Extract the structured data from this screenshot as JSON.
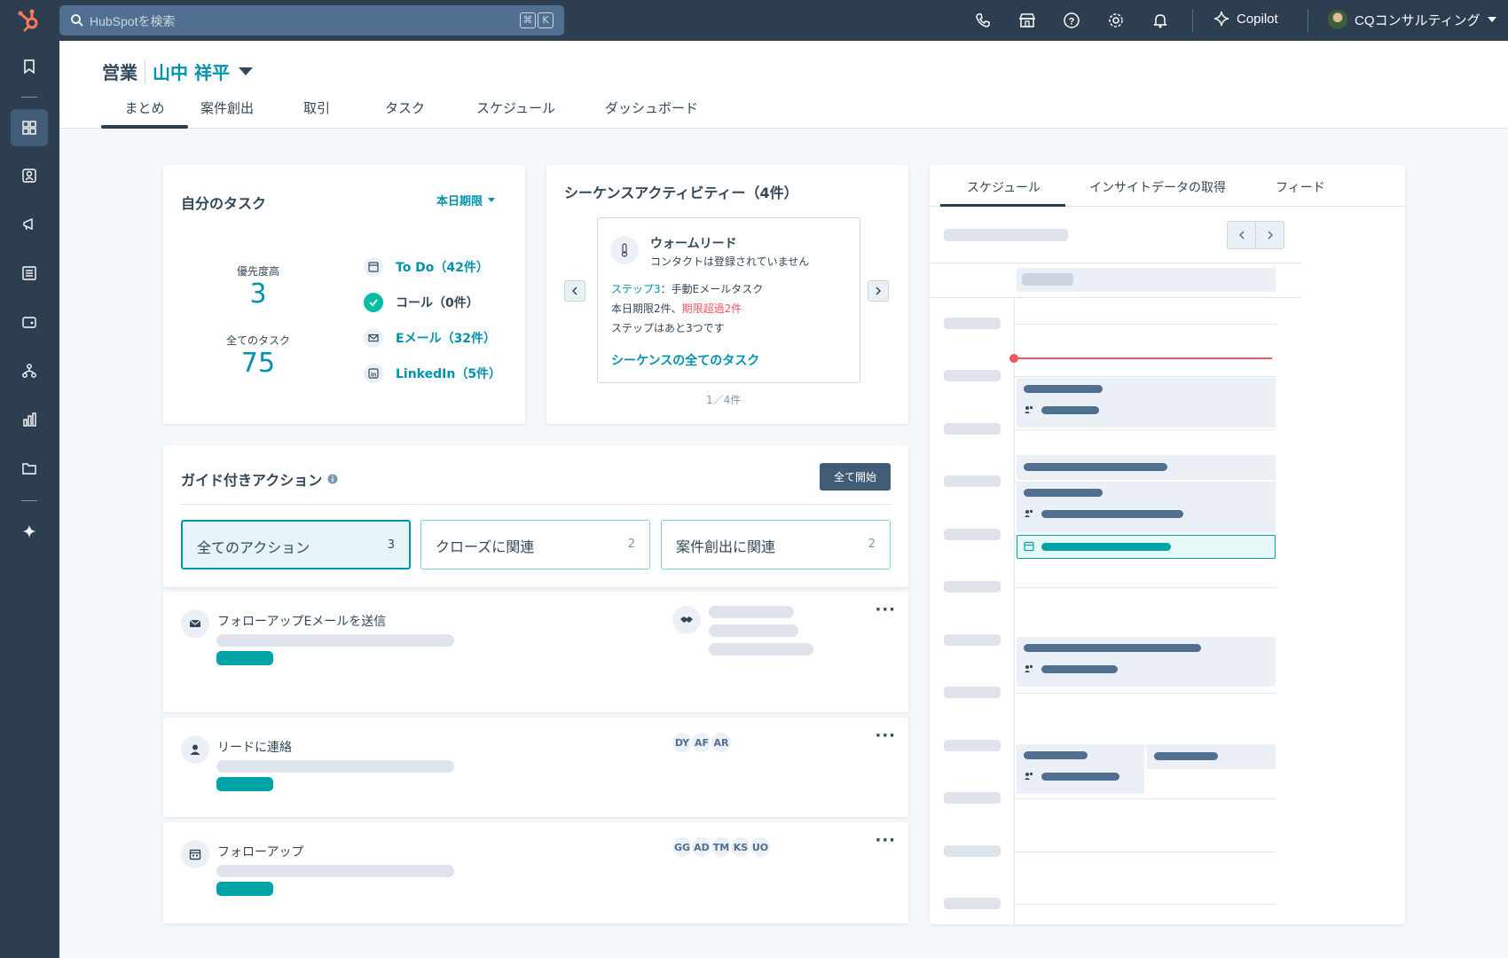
{
  "topbar": {
    "search_placeholder": "HubSpotを検索",
    "kbd": [
      "⌘",
      "K"
    ],
    "copilot_label": "Copilot",
    "account_name": "CQコンサルティング"
  },
  "header": {
    "section": "営業",
    "user": "山中 祥平",
    "tabs": [
      "まとめ",
      "案件創出",
      "取引",
      "タスク",
      "スケジュール",
      "ダッシュボード"
    ]
  },
  "tasks": {
    "title": "自分のタスク",
    "filter": "本日期限",
    "priority_label": "優先度高",
    "priority_value": "3",
    "all_label": "全てのタスク",
    "all_value": "75",
    "rows": [
      {
        "label": "To Do（42件）",
        "icon": "todo-icon"
      },
      {
        "label": "コール（0件）",
        "icon": "check-icon"
      },
      {
        "label": "Eメール（32件）",
        "icon": "email-icon"
      },
      {
        "label": "LinkedIn（5件）",
        "icon": "linkedin-icon"
      }
    ]
  },
  "sequence": {
    "title": "シーケンスアクティビティー（4件）",
    "lead_title": "ウォームリード",
    "lead_sub": "コンタクトは登録されていません",
    "step_label": "ステップ3",
    "step_rest": "：手動Eメールタスク",
    "due_text": "本日期限2件、",
    "overdue_text": "期限超過2件",
    "remaining": "ステップはあと3つです",
    "all_tasks_link": "シーケンスの全てのタスク",
    "pager": "1／4件"
  },
  "guided": {
    "title": "ガイド付きアクション",
    "start_all": "全て開始",
    "filters": [
      {
        "label": "全てのアクション",
        "count": "3"
      },
      {
        "label": "クローズに関連",
        "count": "2"
      },
      {
        "label": "案件創出に関連",
        "count": "2"
      }
    ],
    "actions": [
      {
        "title": "フォローアップEメールを送信",
        "icon": "email-icon"
      },
      {
        "title": "リードに連絡",
        "icon": "person-icon",
        "chips": [
          "DY",
          "AF",
          "AR"
        ]
      },
      {
        "title": "フォローアップ",
        "icon": "calendar-icon",
        "chips": [
          "GG",
          "AD",
          "TM",
          "KS",
          "UO"
        ]
      }
    ]
  },
  "schedule": {
    "tabs": [
      "スケジュール",
      "インサイトデータの取得",
      "フィード"
    ]
  },
  "colors": {
    "topbar": "#2d3e50",
    "accent": "#0091ae",
    "teal": "#00a4a6",
    "overdue": "#f2545b"
  }
}
